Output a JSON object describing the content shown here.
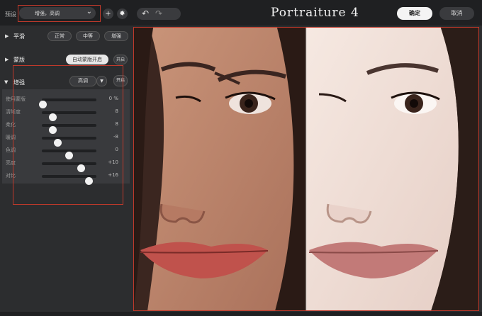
{
  "header": {
    "preset_label": "预设",
    "preset_value": "增强，高调",
    "add_icon": "plus-icon",
    "settings_icon": "gear-icon",
    "undo_icon": "undo-icon",
    "redo_icon": "redo-icon",
    "title": "Portraiture 4",
    "ok_label": "确定",
    "cancel_label": "取消"
  },
  "smooth": {
    "title": "平滑",
    "options": [
      "正常",
      "中等",
      "增强"
    ]
  },
  "mask": {
    "title": "蒙版",
    "auto_label": "自动蒙版开启",
    "toggle": "开启"
  },
  "enhance": {
    "title": "增强",
    "preset": "高调",
    "toggle": "开启",
    "sliders": [
      {
        "label": "使用蒙版",
        "value": "0",
        "unit": "%",
        "fraction": 0.0
      },
      {
        "label": "清晰度",
        "value": "8",
        "unit": "",
        "fraction": 0.18
      },
      {
        "label": "柔化",
        "value": "8",
        "unit": "",
        "fraction": 0.18
      },
      {
        "label": "暖调",
        "value": "-8",
        "unit": "",
        "fraction": 0.26
      },
      {
        "label": "色调",
        "value": "0",
        "unit": "",
        "fraction": 0.5
      },
      {
        "label": "亮度",
        "value": "+10",
        "unit": "",
        "fraction": 0.74
      },
      {
        "label": "对比",
        "value": "+16",
        "unit": "",
        "fraction": 0.9
      }
    ]
  },
  "colors": {
    "annotation_red": "#c0392b",
    "background": "#2c2d2f"
  }
}
